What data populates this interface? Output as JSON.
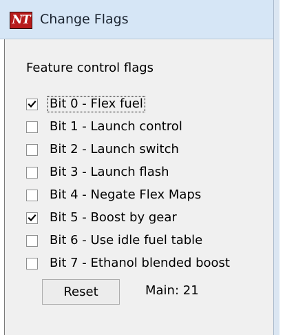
{
  "window": {
    "title": "Change Flags",
    "app_icon_text": "NT",
    "app_icon_color": "#b81c1c",
    "title_bar_color": "#d6e6f6"
  },
  "group": {
    "heading": "Feature control flags"
  },
  "flags": [
    {
      "label": "Bit 0 - Flex fuel",
      "checked": true,
      "focused": true
    },
    {
      "label": "Bit 1 - Launch control",
      "checked": false,
      "focused": false
    },
    {
      "label": "Bit 2 - Launch switch",
      "checked": false,
      "focused": false
    },
    {
      "label": "Bit 3 - Launch flash",
      "checked": false,
      "focused": false
    },
    {
      "label": "Bit 4 - Negate Flex Maps",
      "checked": false,
      "focused": false
    },
    {
      "label": "Bit 5 - Boost by gear",
      "checked": true,
      "focused": false
    },
    {
      "label": "Bit 6 - Use idle fuel table",
      "checked": false,
      "focused": false
    },
    {
      "label": "Bit 7 - Ethanol blended boost",
      "checked": false,
      "focused": false
    }
  ],
  "footer": {
    "reset_label": "Reset",
    "main_value": "Main: 21"
  }
}
